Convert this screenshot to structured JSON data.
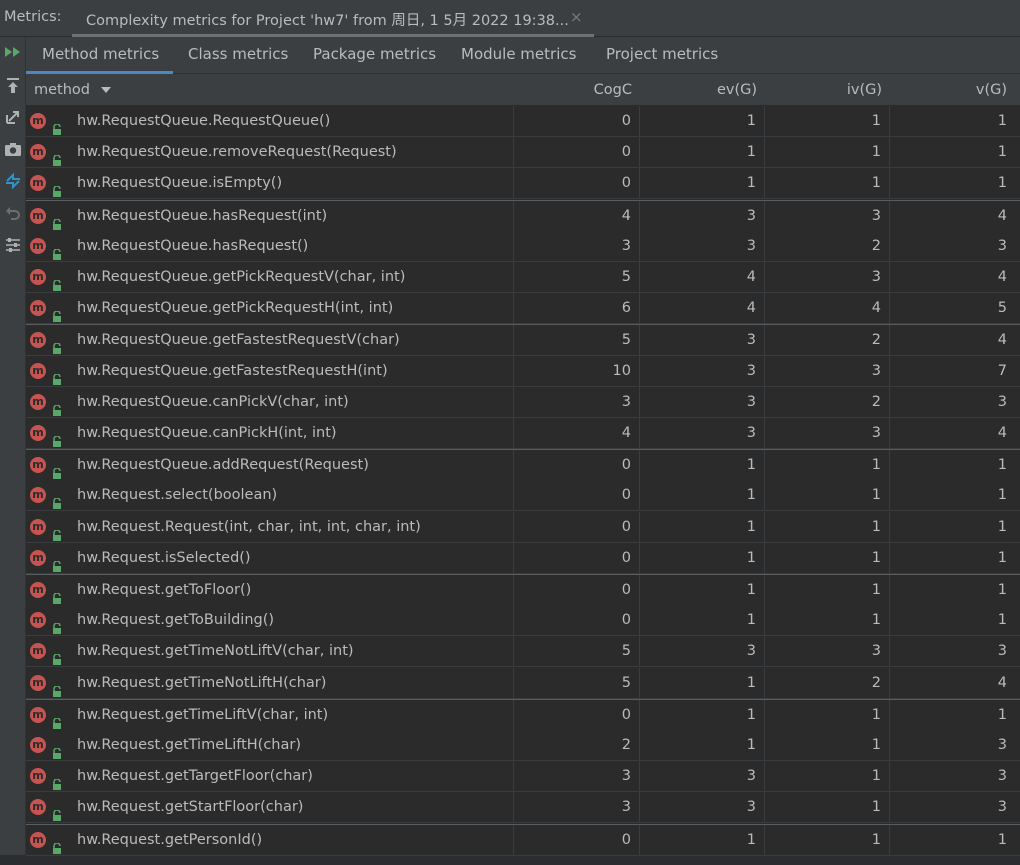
{
  "window": {
    "label": "Metrics:",
    "doc_tab": "Complexity metrics for Project 'hw7' from 周日, 1 5月 2022 19:38...",
    "close_glyph": "×"
  },
  "tools": [
    "run-all-icon",
    "export-icon",
    "expand-icon",
    "snapshot-icon",
    "compare-icon",
    "undo-icon",
    "settings-icon"
  ],
  "tabs": [
    {
      "label": "Method metrics",
      "active": true
    },
    {
      "label": "Class metrics"
    },
    {
      "label": "Package metrics"
    },
    {
      "label": "Module metrics"
    },
    {
      "label": "Project metrics"
    }
  ],
  "columns": {
    "method": "method",
    "cogc": "CogC",
    "ev": "ev(G)",
    "iv": "iv(G)",
    "v": "v(G)"
  },
  "icon_letter": "m",
  "colors": {
    "method_icon": "#c75450",
    "warning_value": "#e0514c",
    "active_tab": "#4a88c7"
  },
  "rows": [
    {
      "method": "hw.RequestQueue.RequestQueue()",
      "cogc": "0",
      "ev": "1",
      "iv": "1",
      "v": "1"
    },
    {
      "method": "hw.RequestQueue.removeRequest(Request)",
      "cogc": "0",
      "ev": "1",
      "iv": "1",
      "v": "1"
    },
    {
      "method": "hw.RequestQueue.isEmpty()",
      "cogc": "0",
      "ev": "1",
      "iv": "1",
      "v": "1"
    },
    {
      "method": "hw.RequestQueue.hasRequest(int)",
      "cogc": "4",
      "ev": "3",
      "iv": "3",
      "v": "4"
    },
    {
      "method": "hw.RequestQueue.hasRequest()",
      "cogc": "3",
      "ev": "3",
      "iv": "2",
      "v": "3"
    },
    {
      "method": "hw.RequestQueue.getPickRequestV(char, int)",
      "cogc": "5",
      "ev": "4",
      "iv": "3",
      "v": "4",
      "ev_warn": true
    },
    {
      "method": "hw.RequestQueue.getPickRequestH(int, int)",
      "cogc": "6",
      "ev": "4",
      "iv": "4",
      "v": "5",
      "ev_warn": true
    },
    {
      "method": "hw.RequestQueue.getFastestRequestV(char)",
      "cogc": "5",
      "ev": "3",
      "iv": "2",
      "v": "4"
    },
    {
      "method": "hw.RequestQueue.getFastestRequestH(int)",
      "cogc": "10",
      "ev": "3",
      "iv": "3",
      "v": "7"
    },
    {
      "method": "hw.RequestQueue.canPickV(char, int)",
      "cogc": "3",
      "ev": "3",
      "iv": "2",
      "v": "3"
    },
    {
      "method": "hw.RequestQueue.canPickH(int, int)",
      "cogc": "4",
      "ev": "3",
      "iv": "3",
      "v": "4"
    },
    {
      "method": "hw.RequestQueue.addRequest(Request)",
      "cogc": "0",
      "ev": "1",
      "iv": "1",
      "v": "1"
    },
    {
      "method": "hw.Request.select(boolean)",
      "cogc": "0",
      "ev": "1",
      "iv": "1",
      "v": "1"
    },
    {
      "method": "hw.Request.Request(int, char, int, int, char, int)",
      "cogc": "0",
      "ev": "1",
      "iv": "1",
      "v": "1"
    },
    {
      "method": "hw.Request.isSelected()",
      "cogc": "0",
      "ev": "1",
      "iv": "1",
      "v": "1"
    },
    {
      "method": "hw.Request.getToFloor()",
      "cogc": "0",
      "ev": "1",
      "iv": "1",
      "v": "1"
    },
    {
      "method": "hw.Request.getToBuilding()",
      "cogc": "0",
      "ev": "1",
      "iv": "1",
      "v": "1"
    },
    {
      "method": "hw.Request.getTimeNotLiftV(char, int)",
      "cogc": "5",
      "ev": "3",
      "iv": "3",
      "v": "3"
    },
    {
      "method": "hw.Request.getTimeNotLiftH(char)",
      "cogc": "5",
      "ev": "1",
      "iv": "2",
      "v": "4"
    },
    {
      "method": "hw.Request.getTimeLiftV(char, int)",
      "cogc": "0",
      "ev": "1",
      "iv": "1",
      "v": "1"
    },
    {
      "method": "hw.Request.getTimeLiftH(char)",
      "cogc": "2",
      "ev": "1",
      "iv": "1",
      "v": "3"
    },
    {
      "method": "hw.Request.getTargetFloor(char)",
      "cogc": "3",
      "ev": "3",
      "iv": "1",
      "v": "3"
    },
    {
      "method": "hw.Request.getStartFloor(char)",
      "cogc": "3",
      "ev": "3",
      "iv": "1",
      "v": "3"
    },
    {
      "method": "hw.Request.getPersonId()",
      "cogc": "0",
      "ev": "1",
      "iv": "1",
      "v": "1"
    }
  ]
}
